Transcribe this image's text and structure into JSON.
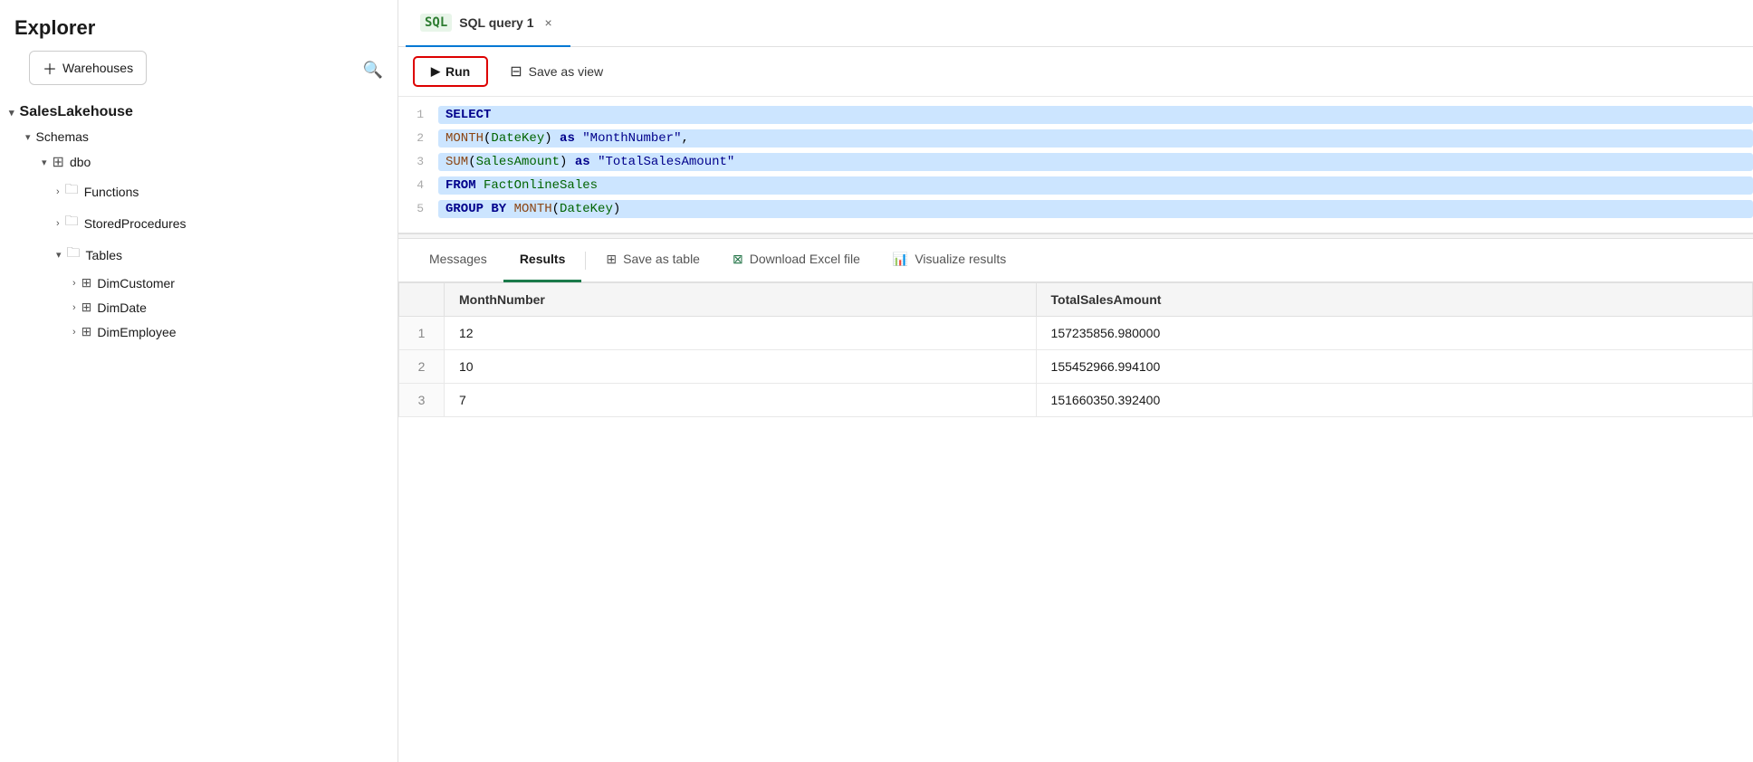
{
  "sidebar": {
    "title": "Explorer",
    "warehouses_label": "Warehouses",
    "search_tooltip": "Search",
    "tree": [
      {
        "level": 0,
        "chevron": "▾",
        "icon": "",
        "label": "SalesLakehouse"
      },
      {
        "level": 1,
        "chevron": "▾",
        "icon": "",
        "label": "Schemas"
      },
      {
        "level": 2,
        "chevron": "▾",
        "icon": "⊞",
        "label": "dbo"
      },
      {
        "level": 3,
        "chevron": "›",
        "icon": "📁",
        "label": "Functions"
      },
      {
        "level": 3,
        "chevron": "›",
        "icon": "📁",
        "label": "StoredProcedures"
      },
      {
        "level": 3,
        "chevron": "▾",
        "icon": "📁",
        "label": "Tables"
      },
      {
        "level": 4,
        "chevron": "›",
        "icon": "⊞",
        "label": "DimCustomer"
      },
      {
        "level": 4,
        "chevron": "›",
        "icon": "⊞",
        "label": "DimDate"
      },
      {
        "level": 4,
        "chevron": "›",
        "icon": "⊞",
        "label": "DimEmployee"
      }
    ]
  },
  "tab": {
    "label": "SQL query 1",
    "close_label": "×"
  },
  "toolbar": {
    "run_label": "Run",
    "save_view_label": "Save as view"
  },
  "code": {
    "lines": [
      {
        "num": "1",
        "tokens": [
          {
            "type": "kw",
            "text": "SELECT"
          }
        ]
      },
      {
        "num": "2",
        "tokens": [
          {
            "type": "fn",
            "text": "MONTH"
          },
          {
            "type": "plain",
            "text": "("
          },
          {
            "type": "id",
            "text": "DateKey"
          },
          {
            "type": "plain",
            "text": ") "
          },
          {
            "type": "kw",
            "text": "as"
          },
          {
            "type": "plain",
            "text": " "
          },
          {
            "type": "str",
            "text": "\"MonthNumber\""
          },
          {
            "type": "plain",
            "text": ","
          }
        ]
      },
      {
        "num": "3",
        "tokens": [
          {
            "type": "fn",
            "text": "SUM"
          },
          {
            "type": "plain",
            "text": "("
          },
          {
            "type": "id",
            "text": "SalesAmount"
          },
          {
            "type": "plain",
            "text": ") "
          },
          {
            "type": "kw",
            "text": "as"
          },
          {
            "type": "plain",
            "text": " "
          },
          {
            "type": "str",
            "text": "\"TotalSalesAmount\""
          }
        ]
      },
      {
        "num": "4",
        "tokens": [
          {
            "type": "kw",
            "text": "FROM"
          },
          {
            "type": "plain",
            "text": " "
          },
          {
            "type": "id",
            "text": "FactOnlineSales"
          }
        ]
      },
      {
        "num": "5",
        "tokens": [
          {
            "type": "kw",
            "text": "GROUP BY"
          },
          {
            "type": "plain",
            "text": " "
          },
          {
            "type": "fn",
            "text": "MONTH"
          },
          {
            "type": "plain",
            "text": "("
          },
          {
            "type": "id",
            "text": "DateKey"
          },
          {
            "type": "plain",
            "text": ")"
          }
        ]
      }
    ]
  },
  "results": {
    "tabs": [
      {
        "id": "messages",
        "label": "Messages",
        "icon": ""
      },
      {
        "id": "results",
        "label": "Results",
        "icon": ""
      },
      {
        "id": "save-table",
        "label": "Save as table",
        "icon": "⊞"
      },
      {
        "id": "download-excel",
        "label": "Download Excel file",
        "icon": "⊠"
      },
      {
        "id": "visualize",
        "label": "Visualize results",
        "icon": "📊"
      }
    ],
    "active_tab": "results",
    "columns": [
      "",
      "MonthNumber",
      "TotalSalesAmount"
    ],
    "rows": [
      {
        "rownum": "1",
        "month": "12",
        "amount": "157235856.980000"
      },
      {
        "rownum": "2",
        "month": "10",
        "amount": "155452966.994100"
      },
      {
        "rownum": "3",
        "month": "7",
        "amount": "151660350.392400"
      }
    ]
  }
}
